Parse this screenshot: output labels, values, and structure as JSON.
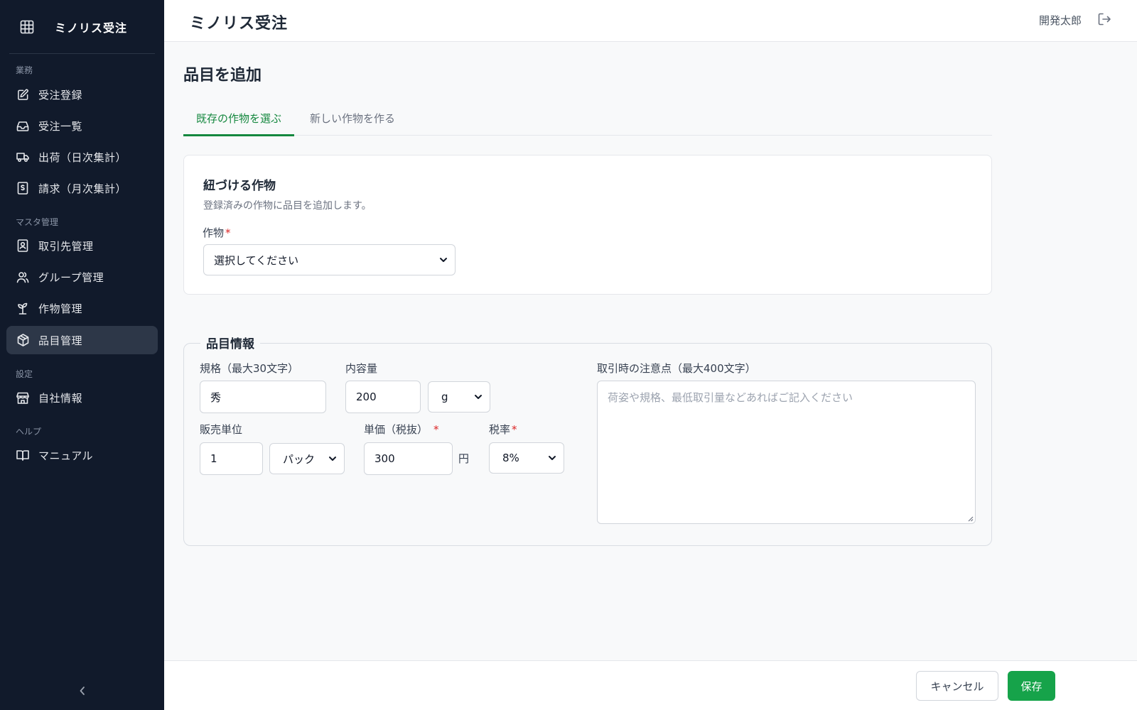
{
  "sidebar": {
    "brand": "ミノリス受注",
    "sections": {
      "business": "業務",
      "master": "マスタ管理",
      "settings": "設定",
      "help": "ヘルプ"
    },
    "items": [
      {
        "label": "受注登録",
        "icon": "edit-icon"
      },
      {
        "label": "受注一覧",
        "icon": "inbox-icon"
      },
      {
        "label": "出荷（日次集計）",
        "icon": "truck-icon"
      },
      {
        "label": "請求（月次集計）",
        "icon": "invoice-icon"
      },
      {
        "label": "取引先管理",
        "icon": "contact-icon"
      },
      {
        "label": "グループ管理",
        "icon": "users-icon"
      },
      {
        "label": "作物管理",
        "icon": "sprout-icon"
      },
      {
        "label": "品目管理",
        "icon": "box-icon",
        "active": true
      },
      {
        "label": "自社情報",
        "icon": "store-icon"
      },
      {
        "label": "マニュアル",
        "icon": "book-icon"
      }
    ],
    "collapse_icon": "chevron-left-icon"
  },
  "header": {
    "title": "ミノリス受注",
    "user": "開発太郎",
    "logout_icon": "logout-icon"
  },
  "page": {
    "title": "品目を追加",
    "tabs": [
      {
        "label": "既存の作物を選ぶ",
        "active": true
      },
      {
        "label": "新しい作物を作る",
        "active": false
      }
    ]
  },
  "crop_card": {
    "title": "紐づける作物",
    "description": "登録済みの作物に品目を追加します。",
    "crop_label": "作物",
    "required_mark": "*",
    "crop_value": "選択してください"
  },
  "item_info": {
    "legend": "品目情報",
    "spec_label": "規格（最大30文字）",
    "spec_value": "秀",
    "content_label": "内容量",
    "content_value": "200",
    "content_unit": "g",
    "sale_unit_label": "販売単位",
    "sale_unit_value": "1",
    "sale_unit_type": "パック",
    "price_label": "単価（税抜）",
    "price_value": "300",
    "price_suffix": "円",
    "tax_label": "税率",
    "tax_value": "8%",
    "notes_label": "取引時の注意点（最大400文字）",
    "notes_placeholder": "荷姿や規格、最低取引量などあればご記入ください"
  },
  "footer": {
    "cancel": "キャンセル",
    "save": "保存"
  },
  "colors": {
    "sidebar_bg": "#111a2b",
    "accent": "#16a34a",
    "required": "#dc2626"
  }
}
